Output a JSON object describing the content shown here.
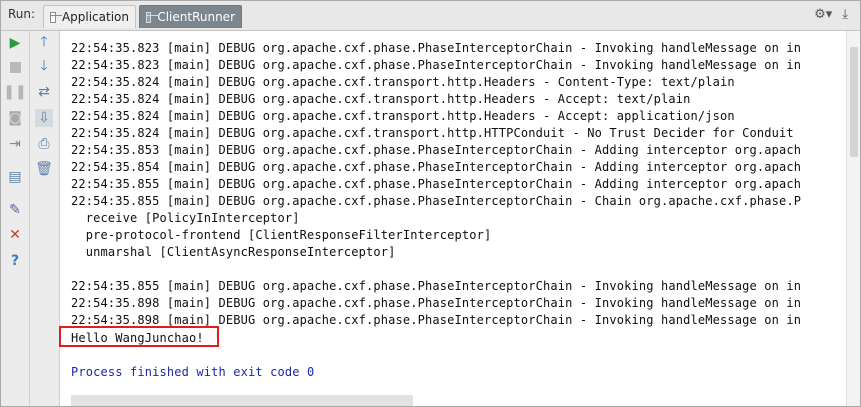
{
  "toolbar": {
    "run_label": "Run:",
    "tabs": [
      {
        "label": "Application",
        "active": false,
        "icon": "window-icon"
      },
      {
        "label": "ClientRunner",
        "active": true,
        "icon": "window-icon"
      }
    ],
    "settings_icon": "gear-icon",
    "pin_icon": "download-arrow-icon"
  },
  "left_toolbar": {
    "col1": [
      "play-icon",
      "stop-icon",
      "pause-icon",
      "camera-icon",
      "exit-icon",
      "layout-icon",
      "pin-icon",
      "close-icon",
      "help-icon"
    ],
    "col2": [
      "arrow-up-icon",
      "arrow-down-icon",
      "soft-wrap-icon",
      "scroll-to-end-icon",
      "print-icon",
      "trash-icon"
    ]
  },
  "console": {
    "lines": [
      "22:54:35.823 [main] DEBUG org.apache.cxf.phase.PhaseInterceptorChain - Invoking handleMessage on in",
      "22:54:35.823 [main] DEBUG org.apache.cxf.phase.PhaseInterceptorChain - Invoking handleMessage on in",
      "22:54:35.824 [main] DEBUG org.apache.cxf.transport.http.Headers - Content-Type: text/plain",
      "22:54:35.824 [main] DEBUG org.apache.cxf.transport.http.Headers - Accept: text/plain",
      "22:54:35.824 [main] DEBUG org.apache.cxf.transport.http.Headers - Accept: application/json",
      "22:54:35.824 [main] DEBUG org.apache.cxf.transport.http.HTTPConduit - No Trust Decider for Conduit",
      "22:54:35.853 [main] DEBUG org.apache.cxf.phase.PhaseInterceptorChain - Adding interceptor org.apach",
      "22:54:35.854 [main] DEBUG org.apache.cxf.phase.PhaseInterceptorChain - Adding interceptor org.apach",
      "22:54:35.855 [main] DEBUG org.apache.cxf.phase.PhaseInterceptorChain - Adding interceptor org.apach",
      "22:54:35.855 [main] DEBUG org.apache.cxf.phase.PhaseInterceptorChain - Chain org.apache.cxf.phase.P",
      "  receive [PolicyInInterceptor]",
      "  pre-protocol-frontend [ClientResponseFilterInterceptor]",
      "  unmarshal [ClientAsyncResponseInterceptor]",
      "",
      "22:54:35.855 [main] DEBUG org.apache.cxf.phase.PhaseInterceptorChain - Invoking handleMessage on in",
      "22:54:35.898 [main] DEBUG org.apache.cxf.phase.PhaseInterceptorChain - Invoking handleMessage on in",
      "22:54:35.898 [main] DEBUG org.apache.cxf.phase.PhaseInterceptorChain - Invoking handleMessage on in",
      "Hello WangJunchao!",
      "",
      "Process finished with exit code 0"
    ],
    "highlighted_line_index": 17,
    "exit_line_index": 19,
    "exit_color": "#1a2aa6",
    "highlight_color": "#e01e1e"
  }
}
